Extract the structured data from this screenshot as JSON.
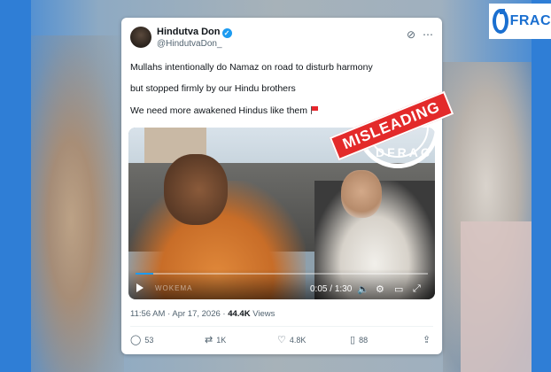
{
  "brand": {
    "logo_text": "FRAC",
    "accent": "#1a6fd0"
  },
  "tweet": {
    "author_name": "Hindutva Don",
    "author_handle": "@HindutvaDon_",
    "verified_icon": "verified-badge-icon",
    "lines": [
      "Mullahs intentionally do Namaz on road to disturb harmony",
      "but stopped firmly by our Hindu brothers",
      "We need more awakened Hindus like them"
    ],
    "video": {
      "current_time": "0:05",
      "duration": "1:30",
      "watermark": "WOKEMA",
      "progress_fraction": 0.06
    },
    "time": "11:56 AM",
    "date": "Apr 17, 2026",
    "views_count": "44.4K",
    "views_label": "Views",
    "actions": {
      "replies": "53",
      "reposts": "1K",
      "likes": "4.8K",
      "bookmarks": "88"
    }
  },
  "stamp": {
    "label": "MISLEADING",
    "ring_text": "DFRAC",
    "color": "#e32a2a"
  }
}
